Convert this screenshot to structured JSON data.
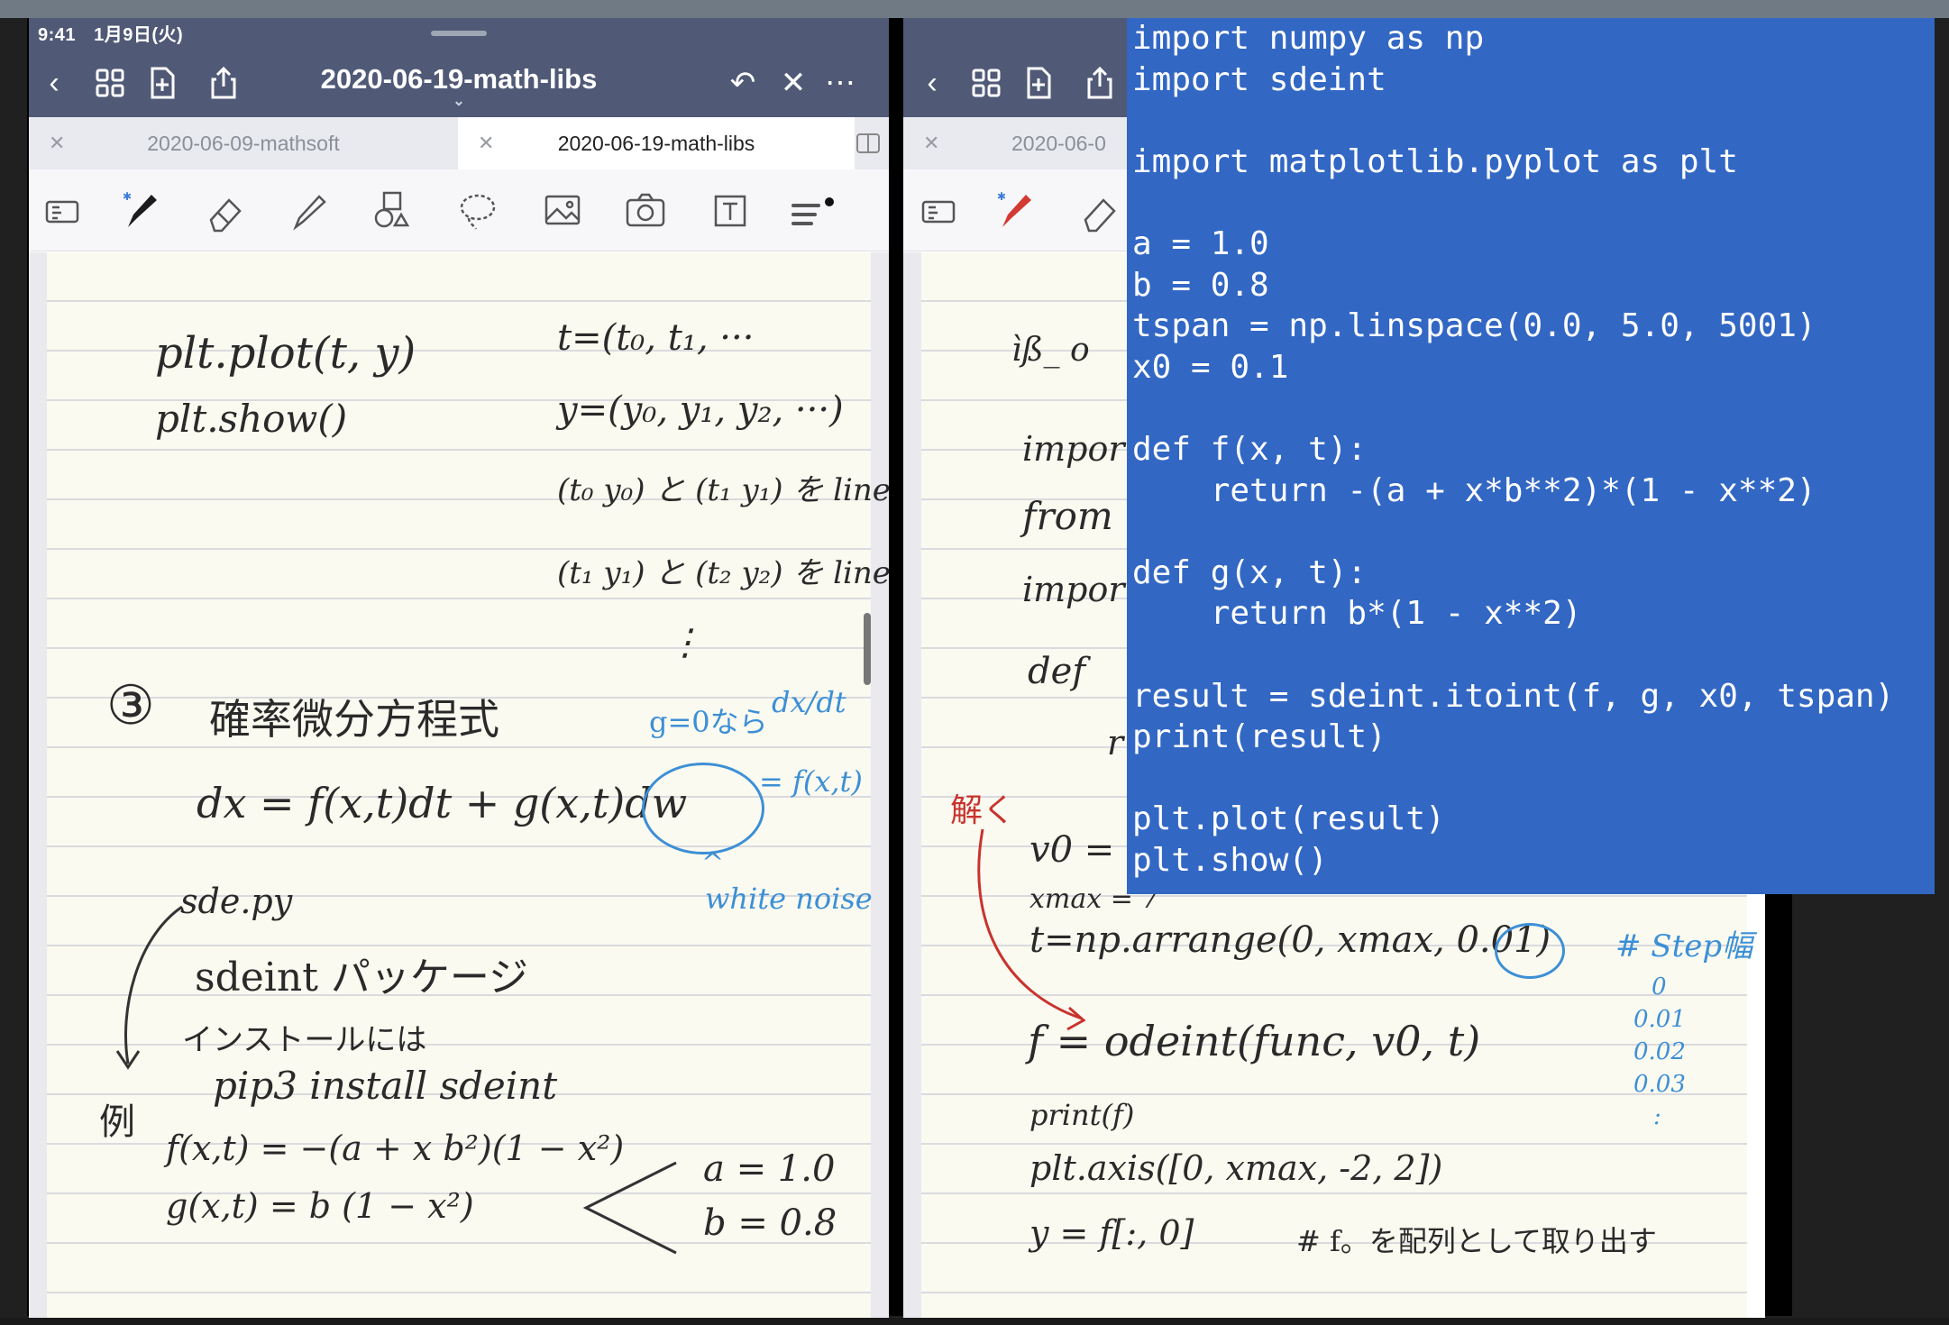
{
  "status_bar": {
    "time": "9:41",
    "date": "1月9日(火)"
  },
  "left_pane": {
    "title": "2020-06-19-math-libs",
    "tabs": [
      {
        "label": "2020-06-09-mathsoft",
        "active": false
      },
      {
        "label": "2020-06-19-math-libs",
        "active": true
      }
    ],
    "notes": [
      "plt.plot(t, y)",
      "plt.show()",
      "t=(t₀, t₁, ···",
      "y=(y₀, y₁, y₂, ···)",
      "(t₀ y₀) と (t₁ y₁) を line",
      "(t₁ y₁) と (t₂ y₂) を line",
      "⋮",
      "③",
      "確率微分方程式",
      "g=0なら",
      "dx/dt",
      "= f(x,t)",
      "dx = f(x,t)dt + g(x,t)dw",
      "white noise",
      "sde.py",
      "sdeint パッケージ",
      "インストールには",
      "pip3  install  sdeint",
      "例",
      "f(x,t) = −(a + x b²)(1 − x²)",
      "g(x,t) = b (1 − x²)",
      "a = 1.0",
      "b = 0.8"
    ]
  },
  "right_pane": {
    "tabs": [
      {
        "label": "2020-06-0",
        "active": false
      }
    ],
    "notes": [
      "ìß_ o",
      "impor",
      "from",
      "impor",
      "def",
      "r",
      "解く",
      "v0 = (",
      "xmax = 7",
      "t=np.arrange(0, xmax, 0.01)",
      "# Step幅",
      "0",
      "0.01",
      "0.02",
      "0.03",
      ":",
      "f = odeint(func, v0, t)",
      "print(f)",
      "plt.axis([0, xmax, -2, 2])",
      "y = f[:, 0]",
      "# f。を配列として取り出す"
    ]
  },
  "code_overlay": {
    "lines": [
      "import numpy as np",
      "import sdeint",
      "",
      "import matplotlib.pyplot as plt",
      "",
      "a = 1.0",
      "b = 0.8",
      "tspan = np.linspace(0.0, 5.0, 5001)",
      "x0 = 0.1",
      "",
      "def f(x, t):",
      "    return -(a + x*b**2)*(1 - x**2)",
      "",
      "def g(x, t):",
      "    return b*(1 - x**2)",
      "",
      "result = sdeint.itoint(f, g, x0, tspan)",
      "print(result)",
      "",
      "plt.plot(result)",
      "plt.show()"
    ]
  },
  "colors": {
    "navbar": "#505a77",
    "code_bg": "#3267c4",
    "ink_blue": "#3d8fd6",
    "ink_red": "#c9332e"
  }
}
